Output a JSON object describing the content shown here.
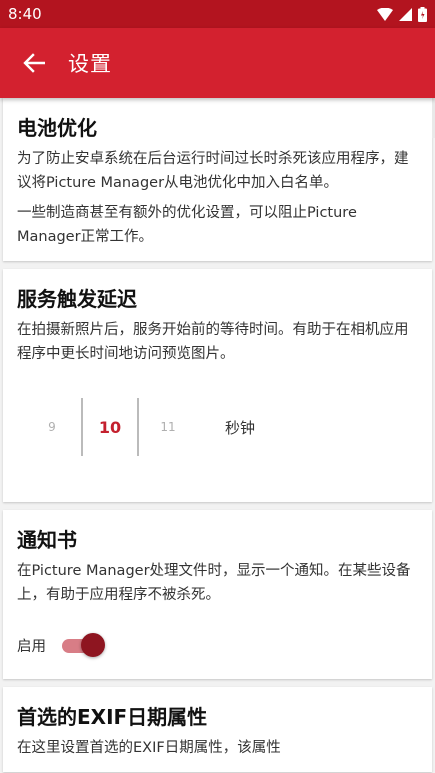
{
  "status_bar": {
    "time": "8:40"
  },
  "app_bar": {
    "title": "设置"
  },
  "cards": {
    "battery": {
      "title": "电池优化",
      "text1": "为了防止安卓系统在后台运行时间过长时杀死该应用程序，建议将Picture Manager从电池优化中加入白名单。",
      "text2": "一些制造商甚至有额外的优化设置，可以阻止Picture Manager正常工作。"
    },
    "delay": {
      "title": "服务触发延迟",
      "text": "在拍摄新照片后，服务开始前的等待时间。有助于在相机应用程序中更长时间地访问预览图片。",
      "picker": {
        "prev": "9",
        "selected": "10",
        "next": "11",
        "unit": "秒钟"
      }
    },
    "notification": {
      "title": "通知书",
      "text": "在Picture Manager处理文件时，显示一个通知。在某些设备上，有助于应用程序不被杀死。",
      "toggle_label": "启用",
      "toggle_on": true
    },
    "exif": {
      "title": "首选的EXIF日期属性",
      "text": "在这里设置首选的EXIF日期属性，该属性"
    }
  },
  "colors": {
    "status_bar": "#b3141f",
    "app_bar": "#d3212f",
    "accent": "#c4202e"
  }
}
